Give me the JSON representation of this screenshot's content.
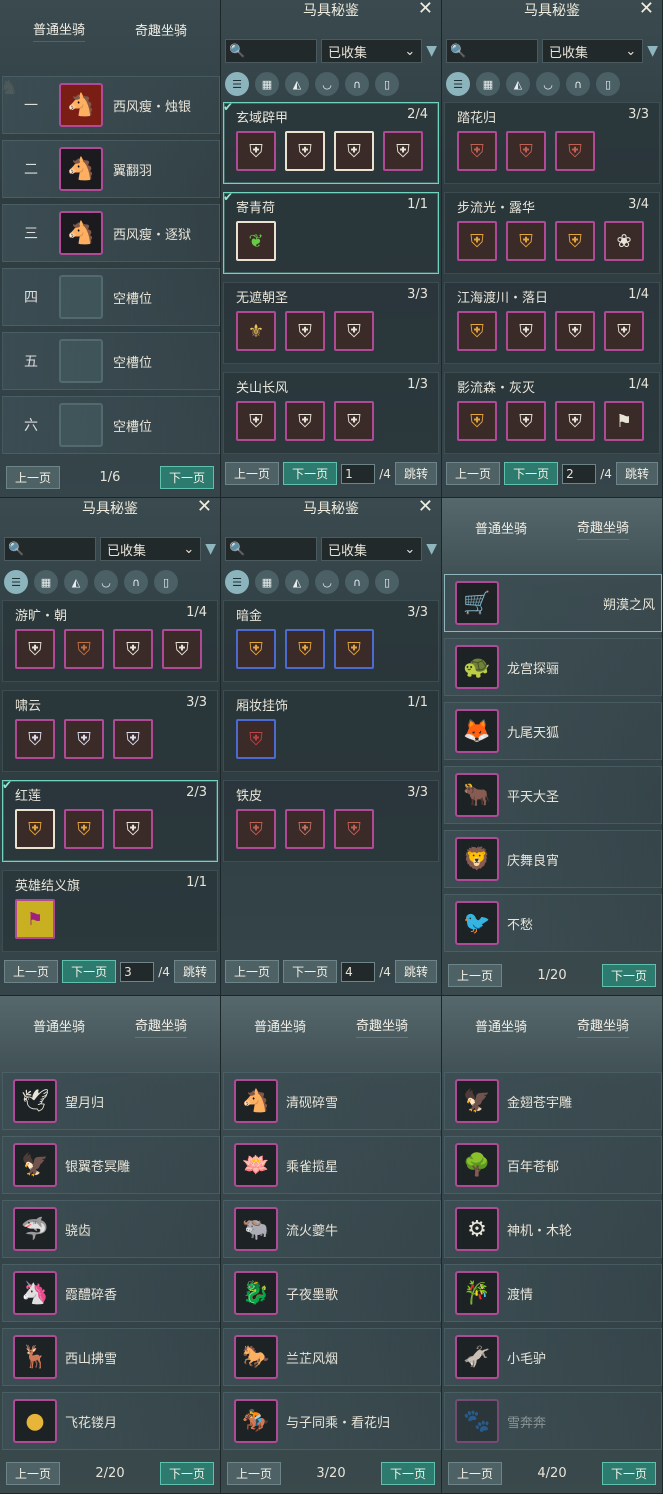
{
  "tabs": {
    "normal": "普通坐骑",
    "fun": "奇趣坐骑"
  },
  "panel1": {
    "slots": [
      {
        "num": "一",
        "name": "西风瘦・烛银",
        "icon": "horse-icon"
      },
      {
        "num": "二",
        "name": "翼翻羽",
        "icon": "horse-icon"
      },
      {
        "num": "三",
        "name": "西风瘦・逐狱",
        "icon": "horse-icon"
      },
      {
        "num": "四",
        "name": "空槽位",
        "icon": "empty-slot-icon"
      },
      {
        "num": "五",
        "name": "空槽位",
        "icon": "empty-slot-icon"
      },
      {
        "num": "六",
        "name": "空槽位",
        "icon": "empty-slot-icon"
      }
    ],
    "prev": "上一页",
    "page": "1/6",
    "next": "下一页"
  },
  "atlas": {
    "title": "马具秘鉴",
    "filter": "已收集",
    "prev": "上一页",
    "next": "下一页",
    "jump": "跳转",
    "total": "/4"
  },
  "panel2": {
    "page": "1",
    "sets": [
      {
        "name": "玄域辟甲",
        "count": "2/4",
        "done": true
      },
      {
        "name": "寄青荷",
        "count": "1/1",
        "done": true
      },
      {
        "name": "无遮朝圣",
        "count": "3/3",
        "done": false
      },
      {
        "name": "关山长风",
        "count": "1/3",
        "done": false
      }
    ]
  },
  "panel3": {
    "page": "2",
    "sets": [
      {
        "name": "踏花归",
        "count": "3/3",
        "done": false
      },
      {
        "name": "步流光・露华",
        "count": "3/4",
        "done": false
      },
      {
        "name": "江海渡川・落日",
        "count": "1/4",
        "done": false
      },
      {
        "name": "影流森・灰灭",
        "count": "1/4",
        "done": false
      }
    ]
  },
  "panel4": {
    "page": "3",
    "sets": [
      {
        "name": "游旷・朝",
        "count": "1/4",
        "done": false
      },
      {
        "name": "啸云",
        "count": "3/3",
        "done": false
      },
      {
        "name": "红莲",
        "count": "2/3",
        "done": true
      },
      {
        "name": "英雄结义旗",
        "count": "1/1",
        "done": false
      }
    ]
  },
  "panel5": {
    "page": "4",
    "sets": [
      {
        "name": "暗金",
        "count": "3/3",
        "done": false
      },
      {
        "name": "厢妆挂饰",
        "count": "1/1",
        "done": false
      },
      {
        "name": "铁皮",
        "count": "3/3",
        "done": false
      }
    ]
  },
  "panel6": {
    "page": "1/20",
    "mounts": [
      "朔漠之风",
      "龙宫探骊",
      "九尾天狐",
      "平天大圣",
      "庆舞良宵",
      "不愁"
    ]
  },
  "panel7": {
    "page": "2/20",
    "mounts": [
      "望月归",
      "银翼苍冥雕",
      "骁齿",
      "霞醴碎香",
      "西山拂雪",
      "飞花镂月"
    ]
  },
  "panel8": {
    "page": "3/20",
    "mounts": [
      "清砚碎雪",
      "乘雀揽星",
      "流火夔牛",
      "子夜墨歌",
      "兰芷风烟",
      "与子同乘・看花归"
    ]
  },
  "panel9": {
    "page": "4/20",
    "mounts": [
      "金翅苍宇雕",
      "百年苍郁",
      "神机・木轮",
      "渡情",
      "小毛驴",
      "雪奔奔"
    ]
  }
}
